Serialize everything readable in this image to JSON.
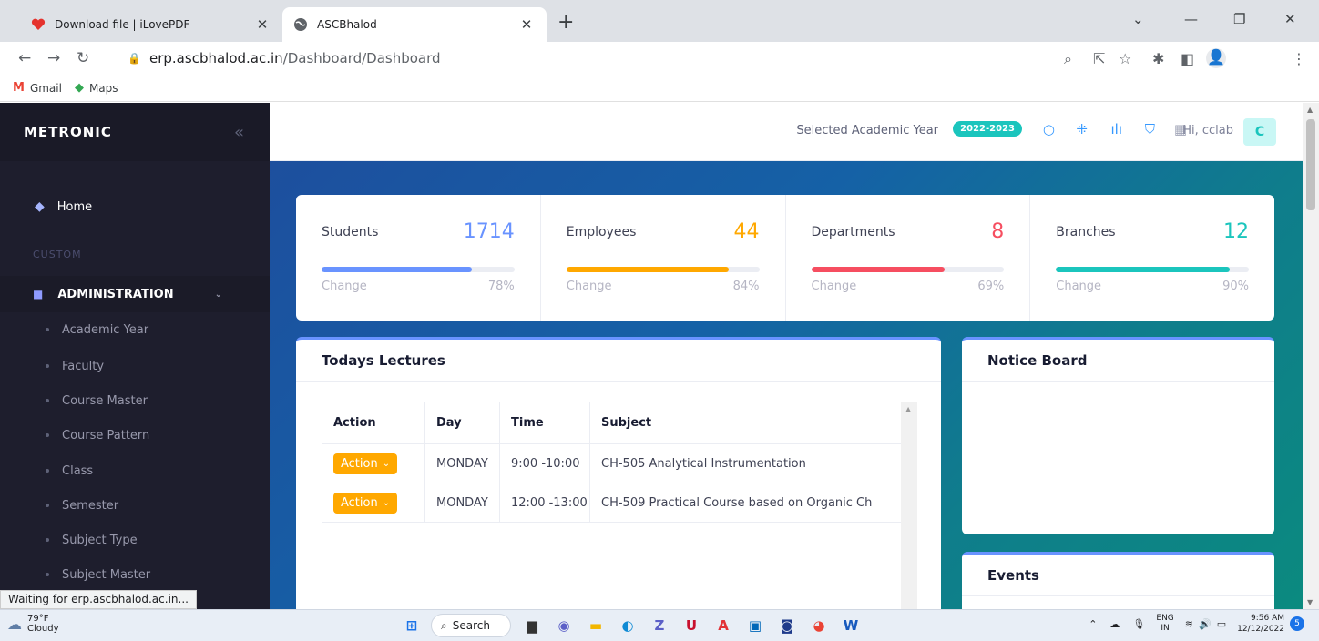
{
  "browser": {
    "tabs": [
      {
        "title": "Download file | iLovePDF",
        "active": false
      },
      {
        "title": "ASCBhalod",
        "active": true
      }
    ],
    "new_tab": "+",
    "url_domain": "erp.ascbhalod.ac.in",
    "url_path": "/Dashboard/Dashboard",
    "bookmarks": [
      {
        "label": "Gmail",
        "icon": "gmail-icon"
      },
      {
        "label": "Maps",
        "icon": "maps-icon"
      }
    ],
    "status_text": "Waiting for erp.ascbhalod.ac.in..."
  },
  "sidebar": {
    "brand": "METRONIC",
    "home": "Home",
    "section": "CUSTOM",
    "group": "ADMINISTRATION",
    "items": [
      "Academic Year",
      "Faculty",
      "Course Master",
      "Course Pattern",
      "Class",
      "Semester",
      "Subject Type",
      "Subject Master"
    ]
  },
  "header": {
    "academic_year_label": "Selected Academic Year",
    "academic_year": "2022-2023",
    "greeting": "Hi, cclab",
    "avatar_letter": "C"
  },
  "stats": [
    {
      "label": "Students",
      "value": "1714",
      "change_label": "Change",
      "change": "78%",
      "progress": 0.78,
      "color": "#6993ff"
    },
    {
      "label": "Employees",
      "value": "44",
      "change_label": "Change",
      "change": "84%",
      "progress": 0.84,
      "color": "#ffa800"
    },
    {
      "label": "Departments",
      "value": "8",
      "change_label": "Change",
      "change": "69%",
      "progress": 0.69,
      "color": "#f64e60"
    },
    {
      "label": "Branches",
      "value": "12",
      "change_label": "Change",
      "change": "90%",
      "progress": 0.9,
      "color": "#1bc5bd"
    }
  ],
  "lectures": {
    "title": "Todays Lectures",
    "columns": [
      "Action",
      "Day",
      "Time",
      "Subject"
    ],
    "rows": [
      {
        "action": "Action",
        "day": "MONDAY",
        "time": "9:00 -10:00",
        "subject": "CH-505 Analytical Instrumentation"
      },
      {
        "action": "Action",
        "day": "MONDAY",
        "time": "12:00 -13:00",
        "subject": "CH-509 Practical Course based on Organic Ch"
      }
    ]
  },
  "notice_board": {
    "title": "Notice Board"
  },
  "events": {
    "title": "Events"
  },
  "taskbar": {
    "temp": "79°F",
    "weather": "Cloudy",
    "search": "Search",
    "lang_top": "ENG",
    "lang_bottom": "IN",
    "time": "9:56 AM",
    "date": "12/12/2022",
    "notifications": "5"
  }
}
